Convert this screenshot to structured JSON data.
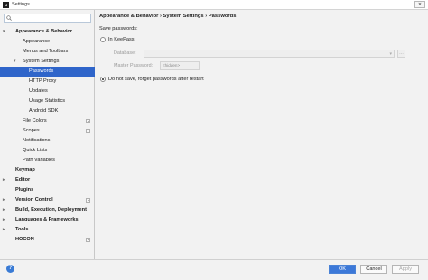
{
  "window": {
    "title": "Settings",
    "app_icon": "intellij-icon",
    "close_label": "✕"
  },
  "search": {
    "value": "",
    "placeholder": ""
  },
  "tree": [
    {
      "label": "Appearance & Behavior",
      "level": 0,
      "bold": true,
      "arrow": "▾"
    },
    {
      "label": "Appearance",
      "level": 1
    },
    {
      "label": "Menus and Toolbars",
      "level": 1
    },
    {
      "label": "System Settings",
      "level": 1,
      "arrow": "▾"
    },
    {
      "label": "Passwords",
      "level": 2,
      "selected": true
    },
    {
      "label": "HTTP Proxy",
      "level": 2
    },
    {
      "label": "Updates",
      "level": 2
    },
    {
      "label": "Usage Statistics",
      "level": 2
    },
    {
      "label": "Android SDK",
      "level": 2
    },
    {
      "label": "File Colors",
      "level": 1,
      "project": true
    },
    {
      "label": "Scopes",
      "level": 1,
      "project": true
    },
    {
      "label": "Notifications",
      "level": 1
    },
    {
      "label": "Quick Lists",
      "level": 1
    },
    {
      "label": "Path Variables",
      "level": 1
    },
    {
      "label": "Keymap",
      "level": 0,
      "bold": true
    },
    {
      "label": "Editor",
      "level": 0,
      "bold": true,
      "arrow": "▸"
    },
    {
      "label": "Plugins",
      "level": 0,
      "bold": true
    },
    {
      "label": "Version Control",
      "level": 0,
      "bold": true,
      "arrow": "▸",
      "project": true
    },
    {
      "label": "Build, Execution, Deployment",
      "level": 0,
      "bold": true,
      "arrow": "▸"
    },
    {
      "label": "Languages & Frameworks",
      "level": 0,
      "bold": true,
      "arrow": "▸"
    },
    {
      "label": "Tools",
      "level": 0,
      "bold": true,
      "arrow": "▸"
    },
    {
      "label": "HOCON",
      "level": 0,
      "bold": true,
      "project": true
    }
  ],
  "breadcrumb": "Appearance & Behavior › System Settings › Passwords",
  "passwords": {
    "save_label": "Save passwords:",
    "keepass_label": "In KeePass",
    "database_label": "Database:",
    "database_value": "",
    "master_password_label": "Master Password:",
    "master_password_value": "<hidden>",
    "no_save_label": "Do not save, forget passwords after restart",
    "selected_option": "no_save"
  },
  "footer": {
    "help_icon": "?",
    "ok": "OK",
    "cancel": "Cancel",
    "apply": "Apply"
  },
  "colors": {
    "selection": "#2f65ca",
    "primary_button": "#3c78d8"
  }
}
